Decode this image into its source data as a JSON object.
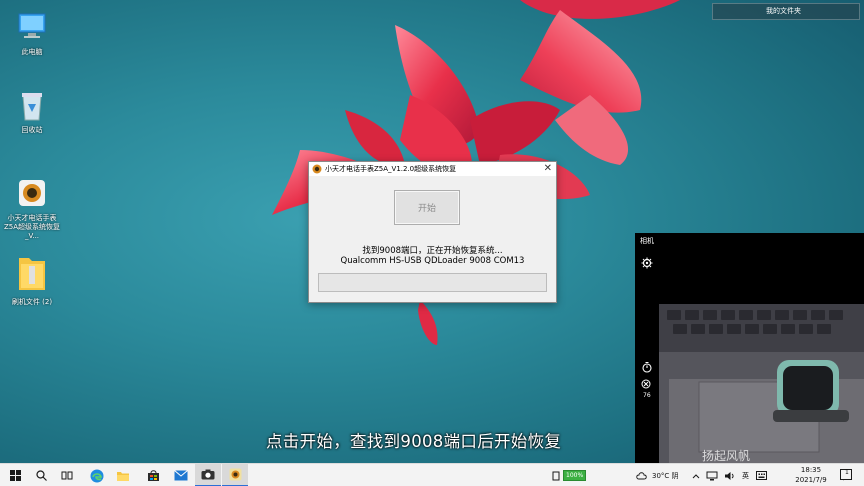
{
  "desktop": {
    "icons": [
      {
        "label": "此电脑",
        "icon": "pc-icon"
      },
      {
        "label": "回收站",
        "icon": "recycle-bin-icon"
      },
      {
        "label": "小天才电话手表Z5A超级系统恢复_V...",
        "icon": "app-icon"
      },
      {
        "label": "刷机文件 (2)",
        "icon": "folder-icon"
      }
    ],
    "top_right_label": "我的文件夹"
  },
  "dialog": {
    "title": "小天才电话手表Z5A_V1.2.0超级系统恢复",
    "close_glyph": "✕",
    "start_button": "开始",
    "status_line1": "找到9008端口，正在开始恢复系统...",
    "status_line2": "Qualcomm HS-USB QDLoader 9008 COM13",
    "progress": 0
  },
  "camera": {
    "title": "相机",
    "counter": "76"
  },
  "subtitle": "点击开始，查找到9008端口后开始恢复",
  "watermark": "扬起风帆",
  "taskbar": {
    "battery_label": "100%",
    "weather": "30°C 阴",
    "ime": "英",
    "time": "18:35",
    "date": "2021/7/9",
    "notification_count": "1"
  },
  "colors": {
    "accent": "#2b6fd6",
    "petal": "#e23a52"
  }
}
